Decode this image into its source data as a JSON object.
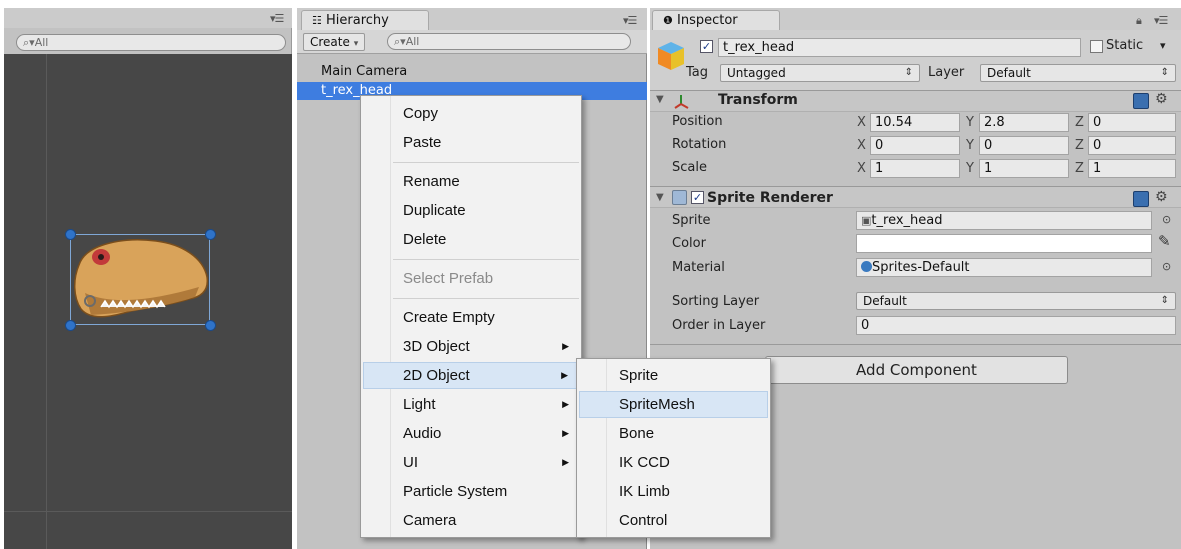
{
  "scene": {
    "search_placeholder": "All",
    "sprite_name": "t_rex_head"
  },
  "hierarchy": {
    "tab_label": "Hierarchy",
    "create_label": "Create",
    "search_placeholder": "All",
    "items": [
      {
        "label": "Main Camera"
      },
      {
        "label": "t_rex_head"
      }
    ]
  },
  "inspector": {
    "tab_label": "Inspector",
    "object_name": "t_rex_head",
    "static_label": "Static",
    "tag_label": "Tag",
    "tag_value": "Untagged",
    "layer_label": "Layer",
    "layer_value": "Default",
    "transform": {
      "title": "Transform",
      "position_label": "Position",
      "rotation_label": "Rotation",
      "scale_label": "Scale",
      "axis_x": "X",
      "axis_y": "Y",
      "axis_z": "Z",
      "position": {
        "x": "10.54",
        "y": "2.8",
        "z": "0"
      },
      "rotation": {
        "x": "0",
        "y": "0",
        "z": "0"
      },
      "scale": {
        "x": "1",
        "y": "1",
        "z": "1"
      }
    },
    "sprite_renderer": {
      "title": "Sprite Renderer",
      "sprite_label": "Sprite",
      "sprite_value": "t_rex_head",
      "color_label": "Color",
      "material_label": "Material",
      "material_value": "Sprites-Default",
      "sorting_layer_label": "Sorting Layer",
      "sorting_layer_value": "Default",
      "order_label": "Order in Layer",
      "order_value": "0"
    },
    "add_component_label": "Add Component"
  },
  "context_menu": {
    "items": [
      {
        "label": "Copy"
      },
      {
        "label": "Paste"
      },
      {
        "label": "Rename"
      },
      {
        "label": "Duplicate"
      },
      {
        "label": "Delete"
      },
      {
        "label": "Select Prefab"
      },
      {
        "label": "Create Empty"
      },
      {
        "label": "3D Object"
      },
      {
        "label": "2D Object"
      },
      {
        "label": "Light"
      },
      {
        "label": "Audio"
      },
      {
        "label": "UI"
      },
      {
        "label": "Particle System"
      },
      {
        "label": "Camera"
      }
    ]
  },
  "submenu": {
    "items": [
      {
        "label": "Sprite"
      },
      {
        "label": "SpriteMesh"
      },
      {
        "label": "Bone"
      },
      {
        "label": "IK CCD"
      },
      {
        "label": "IK Limb"
      },
      {
        "label": "Control"
      }
    ]
  },
  "colors": {
    "selection_blue": "#3e7de0",
    "panel_gray": "#c2c2c2",
    "scene_bg": "#474747"
  },
  "icons": [
    "menu-lines-icon",
    "search-icon",
    "dropdown-arrow-icon",
    "cube-icon",
    "transform-icon",
    "sprite-renderer-icon",
    "help-book-icon",
    "gear-icon",
    "object-picker-icon",
    "eyedropper-icon",
    "material-sphere-icon",
    "lock-icon",
    "info-icon",
    "submenu-arrow-icon"
  ]
}
